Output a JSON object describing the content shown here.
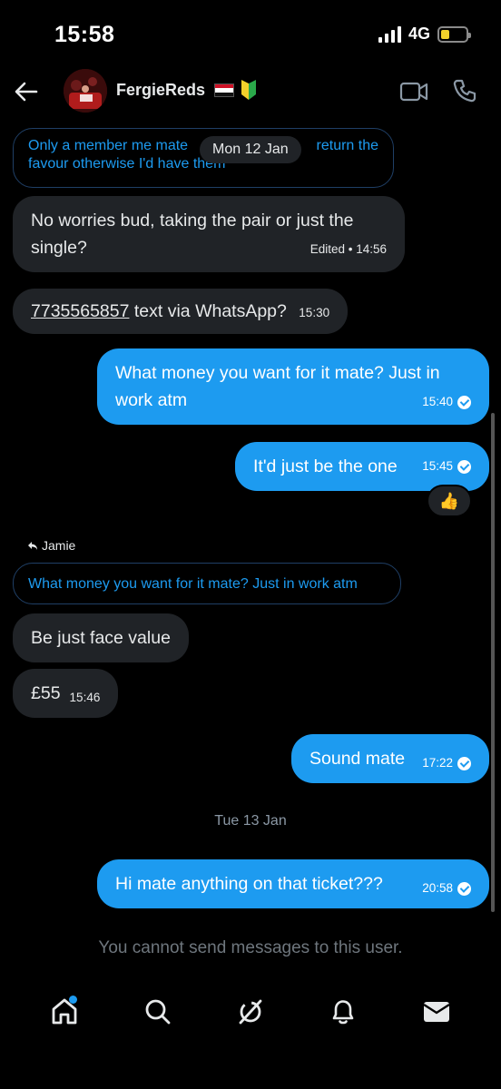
{
  "status_bar": {
    "time": "15:58",
    "network": "4G"
  },
  "header": {
    "contact_name": "FergieReds"
  },
  "date_pill": "Mon 12 Jan",
  "messages": {
    "reply_quote_1": "Only a member me mate so I'll return the favour otherwise I'd have them",
    "reply_quote_1_left": "Only a member me mate",
    "reply_quote_1_right": "return the",
    "reply_quote_1_line2": "favour otherwise I'd have them",
    "in_1_line1": "No worries bud, taking the pair or just the",
    "in_1_line2": "single?",
    "in_1_meta": "Edited • 14:56",
    "in_2_phone": "7735565857",
    "in_2_text": " text via WhatsApp?",
    "in_2_time": "15:30",
    "out_1_line1": "What money you want for it mate? Just in",
    "out_1_line2": "work atm",
    "out_1_time": "15:40",
    "out_2_text": "It'd just be the one",
    "out_2_time": "15:45",
    "out_2_reaction": "👍",
    "reply_label": "Jamie",
    "reply_quote_2": "What money you want for it mate? Just in work atm",
    "in_3_text": "Be just face value",
    "in_4_text": "£55",
    "in_4_time": "15:46",
    "out_3_text": "Sound mate",
    "out_3_time": "17:22",
    "date_divider": "Tue 13 Jan",
    "out_4_text": "Hi mate anything on that ticket???",
    "out_4_time": "20:58"
  },
  "notice": "You cannot send messages to this user.",
  "icons": {
    "back": "arrow-left-icon",
    "video": "video-camera-icon",
    "phone": "phone-icon",
    "home": "home-icon",
    "search": "search-icon",
    "grok": "grok-icon",
    "notifications": "bell-icon",
    "messages": "envelope-icon"
  },
  "colors": {
    "accent": "#1d9bf0",
    "incoming_bubble": "#202327",
    "background": "#000000"
  }
}
